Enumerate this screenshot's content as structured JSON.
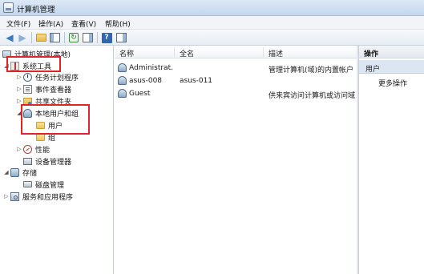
{
  "window": {
    "title": "计算机管理"
  },
  "menu": [
    "文件(F)",
    "操作(A)",
    "查看(V)",
    "帮助(H)"
  ],
  "tree": {
    "root": "计算机管理(本地)",
    "system_tools": "系统工具",
    "task_scheduler": "任务计划程序",
    "event_viewer": "事件查看器",
    "shared_folders": "共享文件夹",
    "local_users_groups": "本地用户和组",
    "users": "用户",
    "groups": "组",
    "performance": "性能",
    "device_manager": "设备管理器",
    "storage": "存储",
    "disk_management": "磁盘管理",
    "services_apps": "服务和应用程序"
  },
  "list": {
    "columns": [
      "名称",
      "全名",
      "描述"
    ],
    "rows": [
      {
        "name": "Administrat...",
        "fullname": "",
        "description": "管理计算机(域)的内置帐户"
      },
      {
        "name": "asus-008",
        "fullname": "asus-011",
        "description": ""
      },
      {
        "name": "Guest",
        "fullname": "",
        "description": "供来宾访问计算机或访问域的"
      }
    ]
  },
  "actions": {
    "header": "操作",
    "section": "用户",
    "more": "更多操作"
  },
  "colors": {
    "highlight": "#e0242a",
    "selection": "#dce6f2"
  }
}
